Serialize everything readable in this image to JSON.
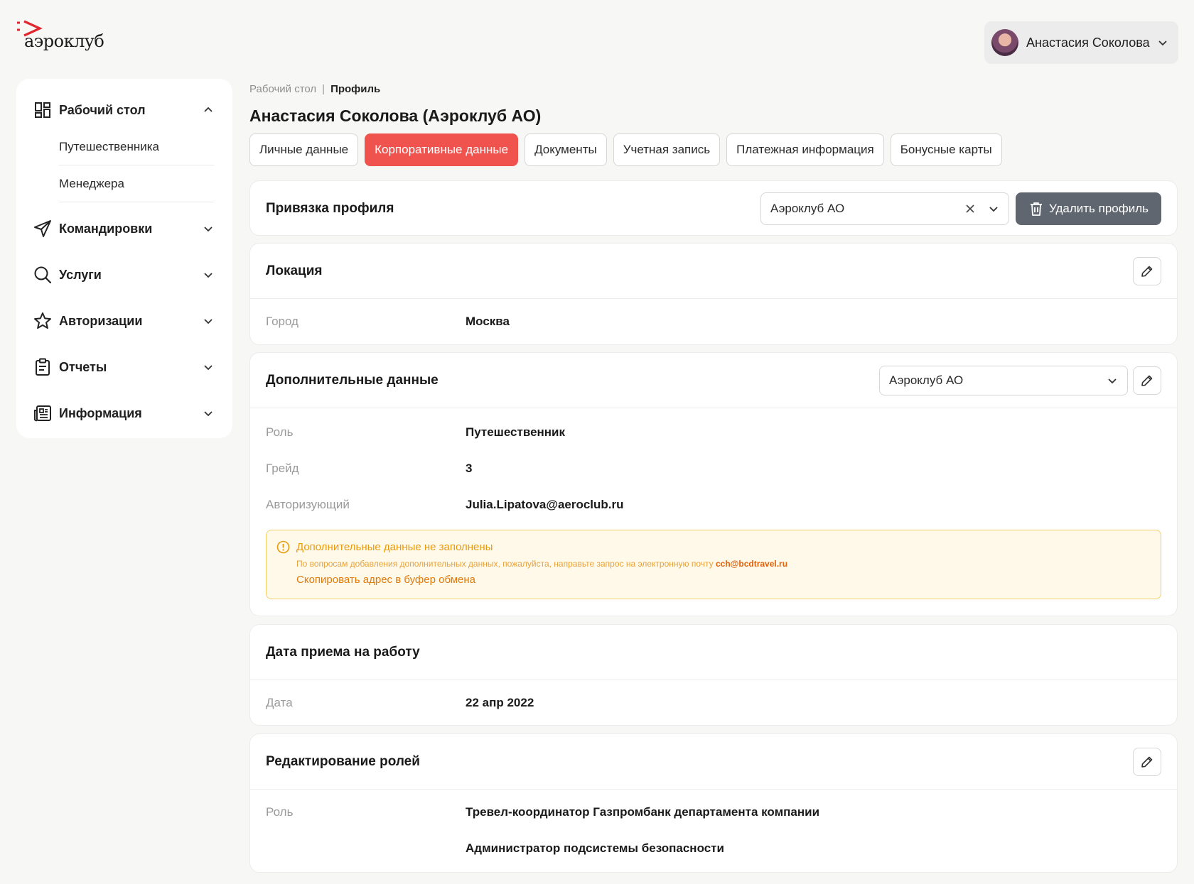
{
  "app": {
    "logo_text": "аэроклуб"
  },
  "user": {
    "name": "Анастасия Соколова"
  },
  "sidebar": {
    "groups": [
      {
        "label": "Рабочий стол",
        "icon": "dashboard-icon",
        "expanded": true,
        "items": [
          {
            "label": "Путешественника"
          },
          {
            "label": "Менеджера"
          }
        ]
      },
      {
        "label": "Командировки",
        "icon": "send-icon"
      },
      {
        "label": "Услуги",
        "icon": "search-icon"
      },
      {
        "label": "Авторизации",
        "icon": "star-icon"
      },
      {
        "label": "Отчеты",
        "icon": "clipboard-icon"
      },
      {
        "label": "Информация",
        "icon": "newspaper-icon"
      }
    ]
  },
  "breadcrumb": {
    "root": "Рабочий стол",
    "current": "Профиль"
  },
  "page": {
    "title": "Анастасия Соколова (Аэроклуб АО)"
  },
  "tabs": [
    {
      "label": "Личные данные",
      "active": false
    },
    {
      "label": "Корпоративные данные",
      "active": true
    },
    {
      "label": "Документы",
      "active": false
    },
    {
      "label": "Учетная запись",
      "active": false
    },
    {
      "label": "Платежная информация",
      "active": false
    },
    {
      "label": "Бонусные карты",
      "active": false
    }
  ],
  "binding": {
    "title": "Привязка профиля",
    "company_value": "Аэроклуб АО",
    "delete_label": "Удалить профиль"
  },
  "location": {
    "title": "Локация",
    "rows": [
      {
        "label": "Город",
        "value": "Москва"
      }
    ]
  },
  "additional": {
    "title": "Дополнительные данные",
    "company_value": "Аэроклуб АО",
    "rows": [
      {
        "label": "Роль",
        "value": "Путешественник"
      },
      {
        "label": "Грейд",
        "value": "3"
      },
      {
        "label": "Авторизующий",
        "value": "Julia.Lipatova@aeroclub.ru"
      }
    ],
    "warning": {
      "title": "Дополнительные данные не заполнены",
      "text": "По вопросам добавления дополнительных данных, пожалуйста, направьте запрос на электронную почту",
      "email": "cch@bcdtravel.ru",
      "link": "Скопировать адрес в буфер обмена"
    }
  },
  "hire": {
    "title": "Дата приема на работу",
    "rows": [
      {
        "label": "Дата",
        "value": "22 апр 2022"
      }
    ]
  },
  "roles": {
    "title": "Редактирование ролей",
    "label": "Роль",
    "values": [
      "Тревел-координатор Газпромбанк департамента компании",
      "Администратор подсистемы безопасности"
    ]
  },
  "colors": {
    "accent": "#f0524d",
    "delete_button": "#5f6670",
    "warning_border": "#f3cf6b",
    "warning_bg": "#fff9ea"
  }
}
